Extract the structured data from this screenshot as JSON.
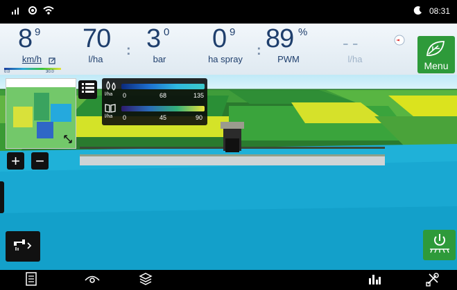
{
  "status": {
    "time": "08:31"
  },
  "gauges": {
    "speed": {
      "value": "8",
      "sup": "9",
      "unit": "km/h"
    },
    "rate": {
      "value": "70",
      "unit": "l/ha"
    },
    "pressure": {
      "value": "3",
      "sup": "0",
      "unit": "bar"
    },
    "area": {
      "value": "0",
      "sup": "9",
      "unit": "ha spray"
    },
    "pwm": {
      "value": "89",
      "sup": "%",
      "unit": "PWM"
    },
    "extra": {
      "value": "- -",
      "unit": "l/ha"
    }
  },
  "menu": {
    "label": "Menu"
  },
  "minimap": {
    "scale_min": "0.0",
    "scale_max": "30.0"
  },
  "legend": {
    "rate": {
      "unit": "l/ha",
      "ticks": [
        "0",
        "68",
        "135"
      ]
    },
    "map": {
      "unit": "l/ha",
      "ticks": [
        "0",
        "45",
        "90"
      ]
    }
  },
  "colors": {
    "accent_green": "#2e9a3a",
    "field_blue": "#1bb0d6",
    "field_green": "#4aa33a",
    "field_yellow": "#e3e21f"
  }
}
